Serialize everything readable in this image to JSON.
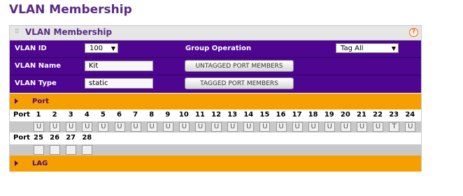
{
  "page": {
    "title": "VLAN Membership"
  },
  "panel": {
    "title": "VLAN Membership",
    "help": "?",
    "vlan_id_label": "VLAN ID",
    "vlan_id_value": "100",
    "group_operation_label": "Group Operation",
    "group_operation_value": "Tag All",
    "vlan_name_label": "VLAN Name",
    "vlan_name_value": "Kit",
    "untagged_button": "UNTAGGED PORT MEMBERS",
    "vlan_type_label": "VLAN Type",
    "vlan_type_value": "static",
    "tagged_button": "TAGGED PORT MEMBERS"
  },
  "port_section": {
    "title": "Port",
    "row_label": "Port",
    "ports_row1": [
      "1",
      "2",
      "3",
      "4",
      "5",
      "6",
      "7",
      "8",
      "9",
      "10",
      "11",
      "12",
      "13",
      "14",
      "15",
      "16",
      "17",
      "18",
      "19",
      "20",
      "21",
      "22",
      "23",
      "24"
    ],
    "states_row1": [
      "U",
      "U",
      "U",
      "U",
      "U",
      "U",
      "U",
      "U",
      "U",
      "U",
      "U",
      "U",
      "U",
      "U",
      "U",
      "U",
      "U",
      "U",
      "U",
      "U",
      "U",
      "U",
      "T",
      "U"
    ],
    "ports_row2": [
      "25",
      "26",
      "27",
      "28"
    ],
    "states_row2": [
      "",
      "",
      "",
      ""
    ]
  },
  "lag_section": {
    "title": "LAG"
  }
}
